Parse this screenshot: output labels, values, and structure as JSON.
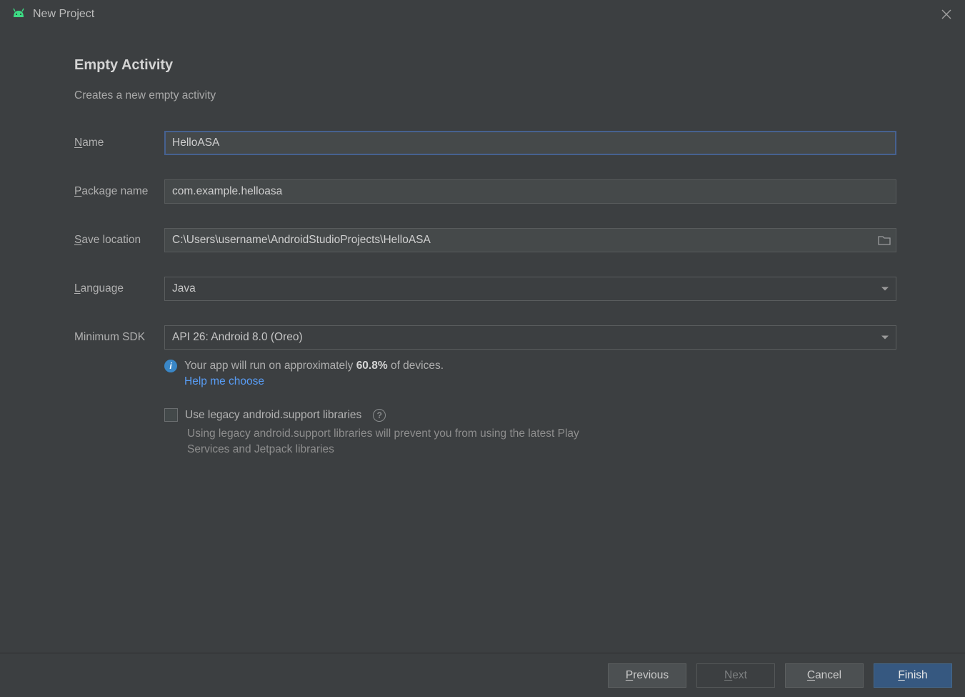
{
  "window": {
    "title": "New Project"
  },
  "header": {
    "title": "Empty Activity",
    "subtitle": "Creates a new empty activity"
  },
  "form": {
    "name": {
      "label_pre": "N",
      "label_rest": "ame",
      "value": "HelloASA"
    },
    "package": {
      "label_pre": "P",
      "label_rest": "ackage name",
      "value": "com.example.helloasa"
    },
    "location": {
      "label_pre": "S",
      "label_rest": "ave location",
      "value": "C:\\Users\\username\\AndroidStudioProjects\\HelloASA"
    },
    "language": {
      "label_pre": "L",
      "label_rest": "anguage",
      "value": "Java"
    },
    "min_sdk": {
      "label": "Minimum SDK",
      "value": "API 26: Android 8.0 (Oreo)"
    }
  },
  "info": {
    "text_pre": "Your app will run on approximately ",
    "percent": "60.8%",
    "text_post": " of devices.",
    "help_link": "Help me choose"
  },
  "legacy": {
    "checkbox_label": "Use legacy android.support libraries",
    "description": "Using legacy android.support libraries will prevent you from using the latest Play Services and Jetpack libraries"
  },
  "buttons": {
    "previous": {
      "pre": "P",
      "rest": "revious"
    },
    "next": {
      "pre": "N",
      "rest": "ext"
    },
    "cancel": {
      "pre": "C",
      "rest": "ancel"
    },
    "finish": {
      "pre": "F",
      "rest": "inish"
    }
  }
}
